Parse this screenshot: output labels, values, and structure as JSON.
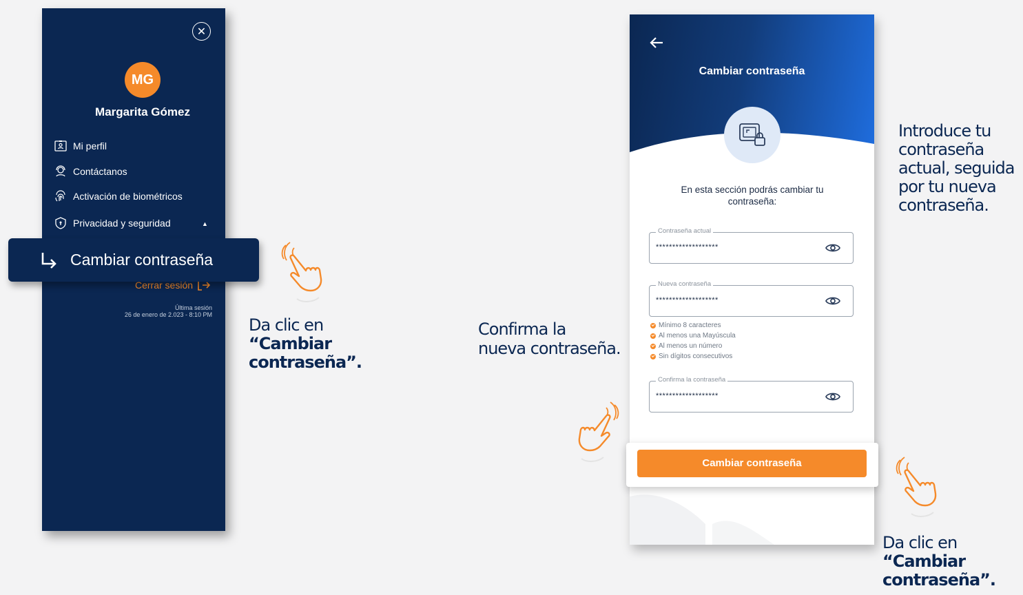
{
  "drawer": {
    "avatar_initials": "MG",
    "user_name": "Margarita Gómez",
    "menu": [
      {
        "label": "Mi perfil",
        "icon": "profile-badge-icon"
      },
      {
        "label": "Contáctanos",
        "icon": "support-agent-icon"
      },
      {
        "label": "Activación de biométricos",
        "icon": "fingerprint-icon"
      },
      {
        "label": "Privacidad y seguridad",
        "icon": "shield-icon"
      }
    ],
    "highlight_label": "Cambiar contraseña",
    "logout_label": "Cerrar sesión",
    "last_session_label": "Última sesión",
    "last_session_date": "26 de enero de 2.023 - 8:10 PM"
  },
  "captions": {
    "left_line1": "Da clic en",
    "left_line2": "“Cambiar",
    "left_line3": "contraseña”.",
    "confirm_line1": "Confirma la",
    "confirm_line2": "nueva contraseña.",
    "intro_line1": "Introduce tu",
    "intro_line2": "contraseña",
    "intro_line3": "actual, seguida",
    "intro_line4": "por tu nueva",
    "intro_line5": "contraseña.",
    "right_line1": "Da clic en",
    "right_line2": "“Cambiar",
    "right_line3": "contraseña”."
  },
  "screen": {
    "title": "Cambiar contraseña",
    "intro_text": "En esta sección podrás cambiar tu contraseña:",
    "fields": [
      {
        "label": "Contraseña actual",
        "value": "*******************"
      },
      {
        "label": "Nueva contraseña",
        "value": "*******************"
      },
      {
        "label": "Confirma la contraseña",
        "value": "*******************"
      }
    ],
    "rules": [
      "Mínimo 8 caracteres",
      "Al menos una Mayúscula",
      "Al menos un número",
      "Sin dígitos consecutivos"
    ],
    "submit_label": "Cambiar contraseña"
  },
  "colors": {
    "navy": "#0b2752",
    "orange": "#f58a2a",
    "blue_gradient_end": "#1f6ee0"
  }
}
